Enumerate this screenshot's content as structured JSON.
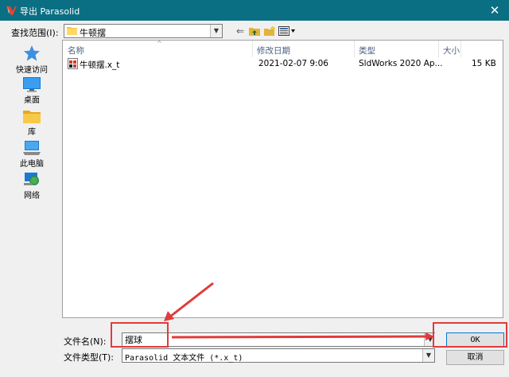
{
  "window": {
    "title": "导出 Parasolid",
    "close_glyph": "✕"
  },
  "look_in": {
    "label": "查找范围(I):",
    "value": "牛顿摆"
  },
  "toolbar": {
    "back_glyph": "⇐"
  },
  "places": [
    {
      "label": "快速访问",
      "icon": "quick-access-star-icon"
    },
    {
      "label": "桌面",
      "icon": "desktop-icon"
    },
    {
      "label": "库",
      "icon": "library-icon"
    },
    {
      "label": "此电脑",
      "icon": "this-pc-icon"
    },
    {
      "label": "网络",
      "icon": "network-icon"
    }
  ],
  "columns": {
    "name": "名称",
    "modified": "修改日期",
    "type": "类型",
    "size": "大小"
  },
  "files": [
    {
      "name": "牛顿摆.x_t",
      "modified": "2021-02-07 9:06",
      "type": "SldWorks 2020 Ap...",
      "size": "15 KB"
    }
  ],
  "file_name": {
    "label": "文件名(N):",
    "value": "摆球"
  },
  "file_type": {
    "label": "文件类型(T):",
    "value": "Parasolid 文本文件 (*.x_t)"
  },
  "buttons": {
    "ok": "OK",
    "cancel": "取消"
  },
  "colors": {
    "titlebar": "#0b6f84",
    "annotation": "#e03b3b"
  }
}
